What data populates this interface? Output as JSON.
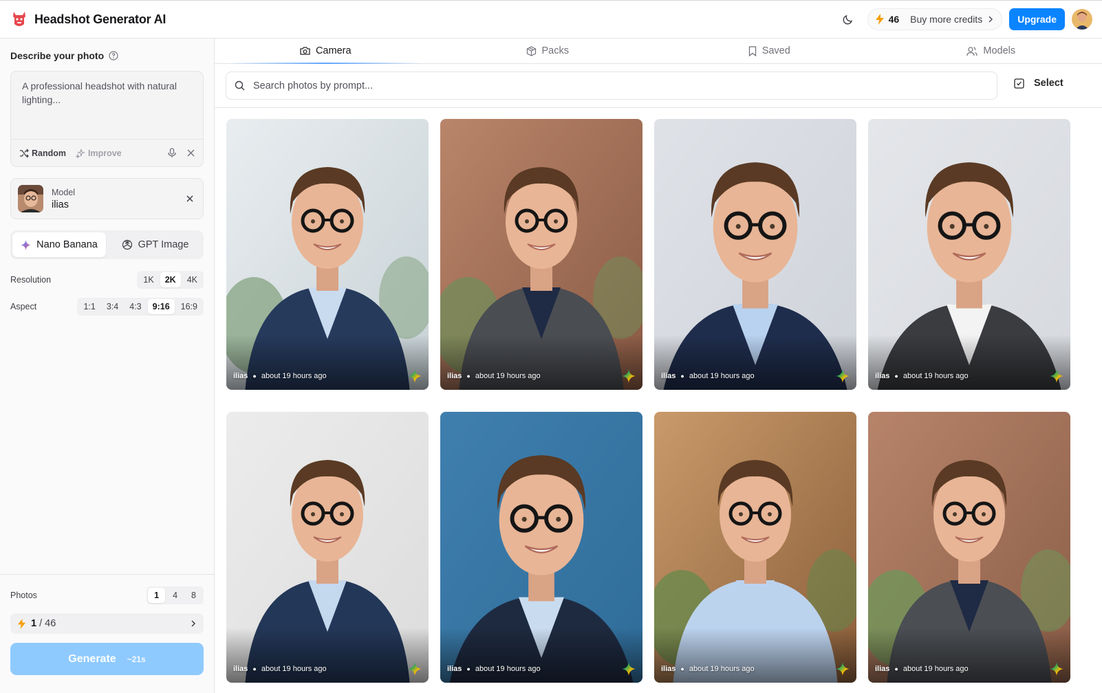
{
  "header": {
    "app_title": "Headshot Generator AI",
    "credits": "46",
    "buy_credits": "Buy more credits",
    "upgrade": "Upgrade"
  },
  "sidebar": {
    "describe_label": "Describe your photo",
    "prompt_placeholder": "A professional headshot with natural lighting...",
    "random": "Random",
    "improve": "Improve",
    "model_label": "Model",
    "model_name": "ilias",
    "engines": [
      {
        "label": "Nano Banana",
        "active": true
      },
      {
        "label": "GPT Image",
        "active": false
      }
    ],
    "resolution": {
      "label": "Resolution",
      "options": [
        "1K",
        "2K",
        "4K"
      ],
      "selected": "2K"
    },
    "aspect": {
      "label": "Aspect",
      "options": [
        "1:1",
        "3:4",
        "4:3",
        "9:16",
        "16:9"
      ],
      "selected": "9:16"
    },
    "photos": {
      "label": "Photos",
      "options": [
        "1",
        "4",
        "8"
      ],
      "selected": "1"
    },
    "cost": {
      "used": "1",
      "separator": "/",
      "total": "46"
    },
    "generate": "Generate",
    "generate_time": "~21s"
  },
  "tabs": [
    {
      "label": "Camera",
      "icon": "camera-icon",
      "active": true
    },
    {
      "label": "Packs",
      "icon": "box-icon",
      "active": false
    },
    {
      "label": "Saved",
      "icon": "bookmark-icon",
      "active": false
    },
    {
      "label": "Models",
      "icon": "users-icon",
      "active": false
    }
  ],
  "search": {
    "placeholder": "Search photos by prompt..."
  },
  "select": "Select",
  "photos": [
    {
      "model": "ilias",
      "time": "about 19 hours ago",
      "bg": "office-window",
      "jacket": "#263a5c",
      "shirt": "#c9dbef"
    },
    {
      "model": "ilias",
      "time": "about 19 hours ago",
      "bg": "office-brick",
      "jacket": "#4a4d52",
      "shirt": "#1f2a44"
    },
    {
      "model": "ilias",
      "time": "about 19 hours ago",
      "bg": "studio-grey",
      "jacket": "#1f2d4d",
      "shirt": "#b9d2f0"
    },
    {
      "model": "ilias",
      "time": "about 19 hours ago",
      "bg": "studio-light",
      "jacket": "#3b3c40",
      "shirt": "#f3f3f3"
    },
    {
      "model": "ilias",
      "time": "about 19 hours ago",
      "bg": "studio-white",
      "jacket": "#233758",
      "shirt": "#c4d8ee"
    },
    {
      "model": "ilias",
      "time": "about 19 hours ago",
      "bg": "studio-blue",
      "jacket": "#1e2a40",
      "shirt": "#c9dcef"
    },
    {
      "model": "ilias",
      "time": "about 19 hours ago",
      "bg": "office-wood",
      "jacket": "#bcd3ee",
      "shirt": "#bcd3ee"
    },
    {
      "model": "ilias",
      "time": "about 19 hours ago",
      "bg": "office-brick2",
      "jacket": "#4b4e53",
      "shirt": "#1f2a44"
    }
  ]
}
